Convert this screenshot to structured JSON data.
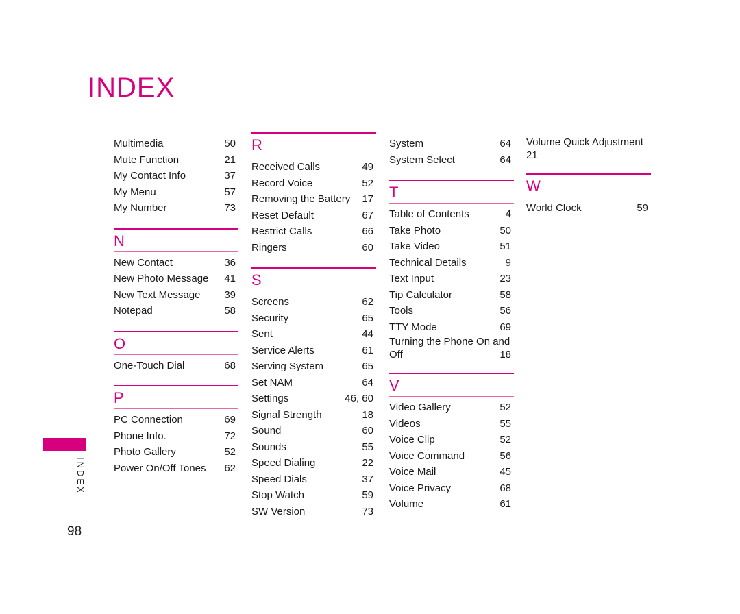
{
  "title": "INDEX",
  "side_label": "INDEX",
  "page_number": "98",
  "colors": {
    "accent": "#d6007f",
    "accent_light": "#e46aa8"
  },
  "columns": [
    {
      "blocks": [
        {
          "letter": "",
          "entries": [
            {
              "name": "Multimedia",
              "page": "50"
            },
            {
              "name": "Mute Function",
              "page": "21"
            },
            {
              "name": "My Contact Info",
              "page": "37"
            },
            {
              "name": "My Menu",
              "page": "57"
            },
            {
              "name": "My Number",
              "page": "73"
            }
          ]
        },
        {
          "letter": "N",
          "entries": [
            {
              "name": "New Contact",
              "page": "36"
            },
            {
              "name": "New Photo Message",
              "page": "41"
            },
            {
              "name": "New Text Message",
              "page": "39"
            },
            {
              "name": "Notepad",
              "page": "58"
            }
          ]
        },
        {
          "letter": "O",
          "entries": [
            {
              "name": "One-Touch Dial",
              "page": "68"
            }
          ]
        },
        {
          "letter": "P",
          "entries": [
            {
              "name": "PC Connection",
              "page": "69"
            },
            {
              "name": "Phone Info.",
              "page": "72"
            },
            {
              "name": "Photo Gallery",
              "page": "52"
            },
            {
              "name": "Power On/Off Tones",
              "page": "62"
            }
          ]
        }
      ]
    },
    {
      "blocks": [
        {
          "letter": "R",
          "entries": [
            {
              "name": "Received Calls",
              "page": "49"
            },
            {
              "name": "Record Voice",
              "page": "52"
            },
            {
              "name": "Removing the Battery",
              "page": "17"
            },
            {
              "name": "Reset Default",
              "page": "67"
            },
            {
              "name": "Restrict Calls",
              "page": "66"
            },
            {
              "name": "Ringers",
              "page": "60"
            }
          ]
        },
        {
          "letter": "S",
          "entries": [
            {
              "name": "Screens",
              "page": "62"
            },
            {
              "name": "Security",
              "page": "65"
            },
            {
              "name": "Sent",
              "page": "44"
            },
            {
              "name": "Service Alerts",
              "page": "61"
            },
            {
              "name": "Serving System",
              "page": "65"
            },
            {
              "name": "Set NAM",
              "page": "64"
            },
            {
              "name": "Settings",
              "page": "46, 60"
            },
            {
              "name": "Signal Strength",
              "page": "18"
            },
            {
              "name": "Sound",
              "page": "60"
            },
            {
              "name": "Sounds",
              "page": "55"
            },
            {
              "name": "Speed Dialing",
              "page": "22"
            },
            {
              "name": "Speed Dials",
              "page": "37"
            },
            {
              "name": "Stop Watch",
              "page": "59"
            },
            {
              "name": "SW Version",
              "page": "73"
            }
          ]
        }
      ]
    },
    {
      "blocks": [
        {
          "letter": "",
          "entries": [
            {
              "name": "System",
              "page": "64"
            },
            {
              "name": "System Select",
              "page": "64"
            }
          ]
        },
        {
          "letter": "T",
          "entries": [
            {
              "name": "Table of Contents",
              "page": "4"
            },
            {
              "name": "Take Photo",
              "page": "50"
            },
            {
              "name": "Take Video",
              "page": "51"
            },
            {
              "name": "Technical Details",
              "page": "9"
            },
            {
              "name": "Text Input",
              "page": "23"
            },
            {
              "name": "Tip Calculator",
              "page": "58"
            },
            {
              "name": "Tools",
              "page": "56"
            },
            {
              "name": "TTY Mode",
              "page": "69"
            },
            {
              "name": "Turning the Phone On and",
              "name2": "Off",
              "page": "18"
            }
          ]
        },
        {
          "letter": "V",
          "entries": [
            {
              "name": "Video Gallery",
              "page": "52"
            },
            {
              "name": "Videos",
              "page": "55"
            },
            {
              "name": "Voice Clip",
              "page": "52"
            },
            {
              "name": "Voice Command",
              "page": "56"
            },
            {
              "name": "Voice Mail",
              "page": "45"
            },
            {
              "name": "Voice Privacy",
              "page": "68"
            },
            {
              "name": "Volume",
              "page": "61"
            }
          ]
        }
      ]
    },
    {
      "blocks": [
        {
          "letter": "",
          "entries": [
            {
              "name": "Volume Quick Adjustment",
              "name2": "21",
              "page": ""
            }
          ]
        },
        {
          "letter": "W",
          "entries": [
            {
              "name": "World Clock",
              "page": "59"
            }
          ]
        }
      ]
    }
  ]
}
